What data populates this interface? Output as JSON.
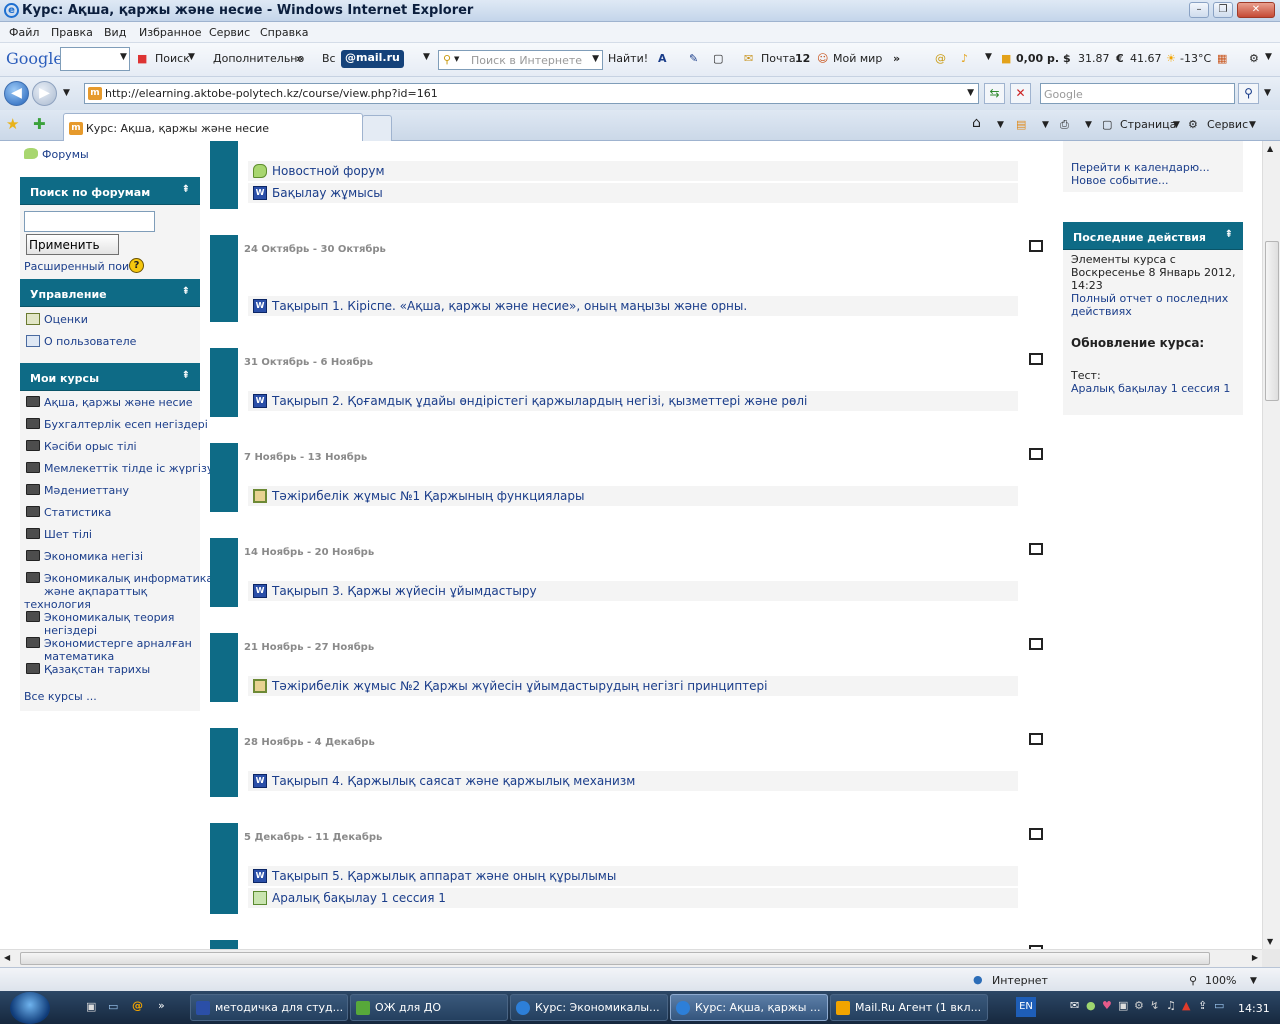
{
  "window": {
    "title": "Курс: Ақша, қаржы және несие - Windows Internet Explorer"
  },
  "menu": [
    "Файл",
    "Правка",
    "Вид",
    "Избранное",
    "Сервис",
    "Справка"
  ],
  "toolbar": {
    "google_logo": "Google",
    "search_label": "Поиск",
    "more_label": "Дополнительно",
    "vs_label": "Вс",
    "mailru_logo": "@mail.ru",
    "internet_search_placeholder": "Поиск в Интернете",
    "find_label": "Найти!",
    "mail_label": "Почта",
    "mail_count": "12",
    "myworld_label": "Мой мир",
    "money": "0,00 р.",
    "usd": "31.87",
    "eur": "41.67",
    "weather": "-13°C"
  },
  "address": {
    "url": "http://elearning.aktobe-polytech.kz/course/view.php?id=161",
    "search_placeholder": "Google"
  },
  "tabs": {
    "active_label": "Курс: Ақша, қаржы және несие",
    "page_label": "Страница",
    "service_label": "Сервис"
  },
  "left": {
    "forums_link": "Форумы",
    "forum_search": {
      "title": "Поиск по форумам",
      "button": "Применить",
      "advanced": "Расширенный поиск",
      "input_value": ""
    },
    "manage": {
      "title": "Управление",
      "items": [
        "Оценки",
        "О пользователе"
      ]
    },
    "my_courses": {
      "title": "Мои курсы",
      "items": [
        "Ақша, қаржы және несие",
        "Бухгалтерлік есеп негіздері",
        "Кәсіби орыс тілі",
        "Мемлекеттік тілде іс жүргізу",
        "Мәдениеттану",
        "Статистика",
        "Шет тілі",
        "Экономика негізі",
        "Экономикалық информатика",
        "және ақпараттық",
        "технология",
        "Экономикалық теория",
        "негіздері",
        "Экономистерге арналған",
        "математика",
        "Қазақстан тарихы"
      ],
      "all_courses": "Все курсы ..."
    }
  },
  "sections": [
    {
      "date": "",
      "items": [
        {
          "type": "forum",
          "text": "Новостной форум"
        },
        {
          "type": "word",
          "text": "Бақылау жұмысы"
        }
      ]
    },
    {
      "date": "24 Октябрь - 30 Октябрь",
      "items": [
        {
          "type": "word",
          "text": "Тақырып 1. Кіріспе. «Ақша, қаржы және несие», оның маңызы және орны."
        }
      ]
    },
    {
      "date": "31 Октябрь - 6 Ноябрь",
      "items": [
        {
          "type": "word",
          "text": "Тақырып 2. Қоғамдық ұдайы өндірістегі қаржылардың негізі, қызметтері және рөлі"
        }
      ]
    },
    {
      "date": "7 Ноябрь - 13 Ноябрь",
      "items": [
        {
          "type": "assign",
          "text": "Тәжірибелік жұмыс №1 Қаржының функциялары"
        }
      ]
    },
    {
      "date": "14 Ноябрь - 20 Ноябрь",
      "items": [
        {
          "type": "word",
          "text": "Тақырып 3. Қаржы жүйесін ұйымдастыру"
        }
      ]
    },
    {
      "date": "21 Ноябрь - 27 Ноябрь",
      "items": [
        {
          "type": "assign",
          "text": "Тәжірибелік жұмыс №2 Қаржы жүйесін ұйымдастырудың негізгі принциптері"
        }
      ]
    },
    {
      "date": "28 Ноябрь - 4 Декабрь",
      "items": [
        {
          "type": "word",
          "text": "Тақырып 4. Қаржылық саясат және қаржылық механизм"
        }
      ]
    },
    {
      "date": "5 Декабрь - 11 Декабрь",
      "items": [
        {
          "type": "word",
          "text": "Тақырып 5. Қаржылық аппарат және оның құрылымы"
        },
        {
          "type": "quiz",
          "text": "Аралық бақылау 1 сессия 1"
        }
      ]
    }
  ],
  "right": {
    "calendar_links": [
      "Перейти к календарю...",
      "Новое событие..."
    ],
    "recent": {
      "title": "Последние действия",
      "since_lines": [
        "Элементы курса с",
        "Воскресенье 8 Январь 2012,",
        "14:23"
      ],
      "full_report_lines": [
        "Полный отчет о последних",
        "действиях"
      ],
      "updates_heading": "Обновление курса:",
      "test_label": "Тест:",
      "test_link": "Аралық бақылау 1 сессия 1"
    }
  },
  "status": {
    "zone": "Интернет",
    "zoom": "100%"
  },
  "taskbar": {
    "tasks": [
      "методичка для студ...",
      "ОЖ  для ДО",
      "Курс: Экономикалы...",
      "Курс: Ақша, қаржы ...",
      "Mail.Ru Агент (1 вкл..."
    ],
    "lang": "EN",
    "clock": "14:31"
  },
  "colors": {
    "moodle_teal": "#0e6b86",
    "link": "#1a3d8a"
  }
}
